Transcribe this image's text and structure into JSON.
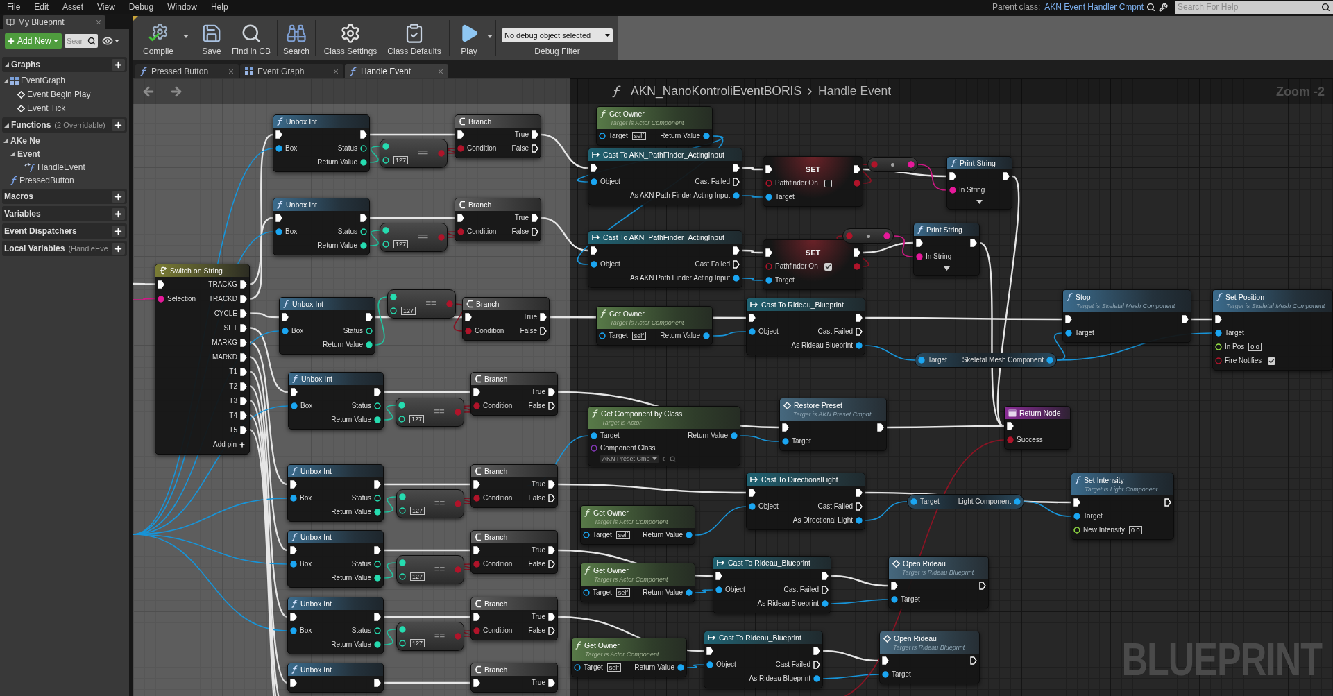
{
  "menu": [
    "File",
    "Edit",
    "Asset",
    "View",
    "Debug",
    "Window",
    "Help"
  ],
  "parent_class": {
    "label": "Parent class:",
    "value": "AKN Event Handler Cmpnt"
  },
  "help_search": {
    "placeholder": "Search For Help"
  },
  "sidebar": {
    "tab": "My Blueprint",
    "add_button": "Add New",
    "search": {
      "placeholder": "Sear"
    },
    "sections": [
      {
        "title": "Graphs",
        "expanded": true,
        "items": [
          {
            "label": "EventGraph",
            "kind": "graph",
            "expanded": true,
            "children": [
              {
                "label": "Event Begin Play",
                "kind": "event"
              },
              {
                "label": "Event Tick",
                "kind": "event"
              }
            ]
          }
        ]
      },
      {
        "title": "Functions",
        "note": "(2 Overridable)",
        "expanded": true,
        "items": [
          {
            "label": "AKe Ne",
            "kind": "category",
            "expanded": true,
            "children": [
              {
                "label": "Event",
                "kind": "category",
                "expanded": true,
                "children": [
                  {
                    "label": "HandleEvent",
                    "kind": "override"
                  }
                ]
              }
            ]
          },
          {
            "label": "PressedButton",
            "kind": "function"
          }
        ]
      },
      {
        "title": "Macros"
      },
      {
        "title": "Variables"
      },
      {
        "title": "Event Dispatchers"
      },
      {
        "title": "Local Variables",
        "note": "(HandleEve"
      }
    ]
  },
  "toolbar": {
    "buttons": [
      {
        "label": "Compile",
        "kind": "compile",
        "menu": true
      },
      {
        "label": "Save",
        "kind": "save",
        "menu": false
      },
      {
        "label": "Find in CB",
        "kind": "find",
        "menu": false
      },
      {
        "label": "Search",
        "kind": "search",
        "menu": false
      },
      {
        "label": "Class Settings",
        "kind": "class_settings",
        "menu": false
      },
      {
        "label": "Class Defaults",
        "kind": "class_defaults",
        "menu": false
      },
      {
        "label": "Play",
        "kind": "play",
        "menu": true
      }
    ],
    "debug_filter": {
      "value": "No debug object selected",
      "label": "Debug Filter"
    }
  },
  "tabs": [
    {
      "label": "Pressed Button",
      "kind": "function",
      "selected": false
    },
    {
      "label": "Event Graph",
      "kind": "graph",
      "selected": false
    },
    {
      "label": "Handle Event",
      "kind": "function",
      "selected": true
    }
  ],
  "graph": {
    "breadcrumb": {
      "blueprint": "AKN_NanoKontroliEventBORIS",
      "function": "Handle Event"
    },
    "zoom": "Zoom -2",
    "label": "BLUEPRINT",
    "nodes": [
      {
        "kind": "switch",
        "title": "Switch on String",
        "inputs": [
          {
            "kind": "exec",
            "linked": true
          },
          {
            "label": "Selection",
            "kind": "string",
            "linked": true
          }
        ],
        "outputs": [
          {
            "label": "TRACKG",
            "kind": "exec",
            "linked": true
          },
          {
            "label": "TRACKD",
            "kind": "exec",
            "linked": true
          },
          {
            "label": "CYCLE",
            "kind": "exec",
            "linked": true
          },
          {
            "label": "SET",
            "kind": "exec",
            "linked": true
          },
          {
            "label": "MARKG",
            "kind": "exec",
            "linked": true
          },
          {
            "label": "MARKD",
            "kind": "exec",
            "linked": true
          },
          {
            "label": "T1",
            "kind": "exec",
            "linked": true
          },
          {
            "label": "T2",
            "kind": "exec",
            "linked": true
          },
          {
            "label": "T3",
            "kind": "exec",
            "linked": true
          },
          {
            "label": "T4",
            "kind": "exec",
            "linked": true
          },
          {
            "label": "T5",
            "kind": "exec",
            "linked": true
          }
        ],
        "add_pin": "Add pin"
      },
      {
        "kind": "function",
        "title": "Unbox Int",
        "inputs": [
          {
            "kind": "exec",
            "linked": true
          },
          {
            "label": "Box",
            "kind": "object",
            "linked": true
          }
        ],
        "outputs": [
          {
            "kind": "exec",
            "linked": true
          },
          {
            "label": "Status",
            "kind": "int",
            "linked": false
          },
          {
            "label": "Return Value",
            "kind": "int",
            "linked": true
          }
        ]
      },
      {
        "kind": "compare",
        "label": "==",
        "inputs": [
          {
            "kind": "int",
            "linked": true
          },
          {
            "kind": "int",
            "linked": false,
            "value": "127"
          }
        ],
        "outputs": [
          {
            "kind": "bool",
            "linked": true
          }
        ]
      },
      {
        "kind": "branch",
        "title": "Branch",
        "inputs": [
          {
            "kind": "exec",
            "linked": true
          },
          {
            "label": "Condition",
            "kind": "bool",
            "linked": true
          }
        ],
        "outputs": [
          {
            "label": "True",
            "kind": "exec",
            "linked": true
          },
          {
            "label": "False",
            "kind": "exec",
            "linked": false
          }
        ]
      },
      {
        "kind": "function",
        "title": "Unbox Int",
        "inputs": [
          {
            "kind": "exec",
            "linked": true
          },
          {
            "label": "Box",
            "kind": "object",
            "linked": true
          }
        ],
        "outputs": [
          {
            "kind": "exec",
            "linked": true
          },
          {
            "label": "Status",
            "kind": "int",
            "linked": false
          },
          {
            "label": "Return Value",
            "kind": "int",
            "linked": true
          }
        ]
      },
      {
        "kind": "compare",
        "label": "==",
        "inputs": [
          {
            "kind": "int",
            "linked": true
          },
          {
            "kind": "int",
            "linked": false,
            "value": "127"
          }
        ],
        "outputs": [
          {
            "kind": "bool",
            "linked": true
          }
        ]
      },
      {
        "kind": "branch",
        "title": "Branch",
        "inputs": [
          {
            "kind": "exec",
            "linked": true
          },
          {
            "label": "Condition",
            "kind": "bool",
            "linked": true
          }
        ],
        "outputs": [
          {
            "label": "True",
            "kind": "exec",
            "linked": true
          },
          {
            "label": "False",
            "kind": "exec",
            "linked": false
          }
        ]
      },
      {
        "kind": "function",
        "title": "Unbox Int",
        "inputs": [
          {
            "kind": "exec",
            "linked": true
          },
          {
            "label": "Box",
            "kind": "object",
            "linked": true
          }
        ],
        "outputs": [
          {
            "kind": "exec",
            "linked": true
          },
          {
            "label": "Status",
            "kind": "int",
            "linked": false
          },
          {
            "label": "Return Value",
            "kind": "int",
            "linked": true
          }
        ]
      },
      {
        "kind": "compare",
        "label": "==",
        "inputs": [
          {
            "kind": "int",
            "linked": true
          },
          {
            "kind": "int",
            "linked": false,
            "value": "127"
          }
        ],
        "outputs": [
          {
            "kind": "bool",
            "linked": true
          }
        ]
      },
      {
        "kind": "branch",
        "title": "Branch",
        "inputs": [
          {
            "kind": "exec",
            "linked": true
          },
          {
            "label": "Condition",
            "kind": "bool",
            "linked": true
          }
        ],
        "outputs": [
          {
            "label": "True",
            "kind": "exec",
            "linked": true
          },
          {
            "label": "False",
            "kind": "exec",
            "linked": false
          }
        ]
      },
      {
        "kind": "function",
        "title": "Unbox Int",
        "inputs": [
          {
            "kind": "exec",
            "linked": true
          },
          {
            "label": "Box",
            "kind": "object",
            "linked": true
          }
        ],
        "outputs": [
          {
            "kind": "exec",
            "linked": true
          },
          {
            "label": "Status",
            "kind": "int",
            "linked": false
          },
          {
            "label": "Return Value",
            "kind": "int",
            "linked": true
          }
        ]
      },
      {
        "kind": "compare",
        "label": "==",
        "inputs": [
          {
            "kind": "int",
            "linked": true
          },
          {
            "kind": "int",
            "linked": false,
            "value": "127"
          }
        ],
        "outputs": [
          {
            "kind": "bool",
            "linked": true
          }
        ]
      },
      {
        "kind": "branch",
        "title": "Branch",
        "inputs": [
          {
            "kind": "exec",
            "linked": true
          },
          {
            "label": "Condition",
            "kind": "bool",
            "linked": true
          }
        ],
        "outputs": [
          {
            "label": "True",
            "kind": "exec",
            "linked": true
          },
          {
            "label": "False",
            "kind": "exec",
            "linked": false
          }
        ]
      },
      {
        "kind": "function",
        "title": "Unbox Int",
        "inputs": [
          {
            "kind": "exec",
            "linked": true
          },
          {
            "label": "Box",
            "kind": "object",
            "linked": true
          }
        ],
        "outputs": [
          {
            "kind": "exec",
            "linked": true
          },
          {
            "label": "Status",
            "kind": "int",
            "linked": false
          },
          {
            "label": "Return Value",
            "kind": "int",
            "linked": true
          }
        ]
      },
      {
        "kind": "compare",
        "label": "==",
        "inputs": [
          {
            "kind": "int",
            "linked": true
          },
          {
            "kind": "int",
            "linked": false,
            "value": "127"
          }
        ],
        "outputs": [
          {
            "kind": "bool",
            "linked": true
          }
        ]
      },
      {
        "kind": "branch",
        "title": "Branch",
        "inputs": [
          {
            "kind": "exec",
            "linked": true
          },
          {
            "label": "Condition",
            "kind": "bool",
            "linked": true
          }
        ],
        "outputs": [
          {
            "label": "True",
            "kind": "exec",
            "linked": true
          },
          {
            "label": "False",
            "kind": "exec",
            "linked": false
          }
        ]
      },
      {
        "kind": "function",
        "title": "Unbox Int",
        "inputs": [
          {
            "kind": "exec",
            "linked": true
          },
          {
            "label": "Box",
            "kind": "object",
            "linked": true
          }
        ],
        "outputs": [
          {
            "kind": "exec",
            "linked": true
          },
          {
            "label": "Status",
            "kind": "int",
            "linked": false
          },
          {
            "label": "Return Value",
            "kind": "int",
            "linked": true
          }
        ]
      },
      {
        "kind": "compare",
        "label": "==",
        "inputs": [
          {
            "kind": "int",
            "linked": true
          },
          {
            "kind": "int",
            "linked": false,
            "value": "127"
          }
        ],
        "outputs": [
          {
            "kind": "bool",
            "linked": true
          }
        ]
      },
      {
        "kind": "branch",
        "title": "Branch",
        "inputs": [
          {
            "kind": "exec",
            "linked": true
          },
          {
            "label": "Condition",
            "kind": "bool",
            "linked": true
          }
        ],
        "outputs": [
          {
            "label": "True",
            "kind": "exec",
            "linked": true
          },
          {
            "label": "False",
            "kind": "exec",
            "linked": false
          }
        ]
      },
      {
        "kind": "function",
        "title": "Unbox Int",
        "inputs": [
          {
            "kind": "exec",
            "linked": true
          },
          {
            "label": "Box",
            "kind": "object",
            "linked": true
          }
        ],
        "outputs": [
          {
            "kind": "exec",
            "linked": true
          },
          {
            "label": "Status",
            "kind": "int",
            "linked": false
          },
          {
            "label": "Return Value",
            "kind": "int",
            "linked": true
          }
        ]
      },
      {
        "kind": "compare",
        "label": "==",
        "inputs": [
          {
            "kind": "int",
            "linked": true
          },
          {
            "kind": "int",
            "linked": false,
            "value": "127"
          }
        ],
        "outputs": [
          {
            "kind": "bool",
            "linked": true
          }
        ]
      },
      {
        "kind": "branch",
        "title": "Branch",
        "inputs": [
          {
            "kind": "exec",
            "linked": true
          },
          {
            "label": "Condition",
            "kind": "bool",
            "linked": true
          }
        ],
        "outputs": [
          {
            "label": "True",
            "kind": "exec",
            "linked": true
          },
          {
            "label": "False",
            "kind": "exec",
            "linked": false
          }
        ]
      },
      {
        "kind": "function",
        "title": "Unbox Int",
        "inputs": [
          {
            "kind": "exec",
            "linked": true
          }
        ],
        "outputs": [
          {
            "kind": "exec",
            "linked": true
          }
        ]
      },
      {
        "kind": "branch",
        "title": "Branch",
        "inputs": [
          {
            "kind": "exec",
            "linked": true
          }
        ],
        "outputs": [
          {
            "label": "True",
            "kind": "exec",
            "linked": true
          }
        ]
      },
      {
        "kind": "pure",
        "title": "Get Owner",
        "subtitle": "Target is Actor Component",
        "inputs": [
          {
            "label": "Target",
            "kind": "object",
            "linked": false,
            "value": "self"
          }
        ],
        "outputs": [
          {
            "label": "Return Value",
            "kind": "object",
            "linked": true
          }
        ]
      },
      {
        "kind": "cast",
        "title": "Cast To AKN_PathFinder_ActingInput",
        "inputs": [
          {
            "kind": "exec",
            "linked": true
          },
          {
            "label": "Object",
            "kind": "object",
            "linked": true
          }
        ],
        "outputs": [
          {
            "kind": "exec",
            "linked": true
          },
          {
            "label": "Cast Failed",
            "kind": "exec",
            "linked": false
          },
          {
            "label": "As AKN Path Finder Acting Input",
            "kind": "object",
            "linked": true
          }
        ]
      },
      {
        "kind": "set",
        "title": "SET",
        "inputs": [
          {
            "kind": "exec",
            "linked": true
          },
          {
            "label": "Pathfinder On",
            "kind": "bool",
            "linked": false,
            "checked": false
          },
          {
            "label": "Target",
            "kind": "object",
            "linked": true
          }
        ],
        "outputs": [
          {
            "kind": "exec",
            "linked": true
          },
          {
            "kind": "bool",
            "linked": true
          }
        ]
      },
      {
        "kind": "convert",
        "inputs": [
          {
            "kind": "bool",
            "linked": true
          }
        ],
        "outputs": [
          {
            "kind": "string",
            "linked": true
          }
        ]
      },
      {
        "kind": "function",
        "title": "Print String",
        "inputs": [
          {
            "kind": "exec",
            "linked": true
          },
          {
            "label": "In String",
            "kind": "string",
            "linked": true
          }
        ],
        "outputs": [
          {
            "kind": "exec",
            "linked": true
          }
        ],
        "advanced_pins_hidden": true
      },
      {
        "kind": "cast",
        "title": "Cast To AKN_PathFinder_ActingInput",
        "inputs": [
          {
            "kind": "exec",
            "linked": true
          },
          {
            "label": "Object",
            "kind": "object",
            "linked": true
          }
        ],
        "outputs": [
          {
            "kind": "exec",
            "linked": true
          },
          {
            "label": "Cast Failed",
            "kind": "exec",
            "linked": false
          },
          {
            "label": "As AKN Path Finder Acting Input",
            "kind": "object",
            "linked": true
          }
        ]
      },
      {
        "kind": "set",
        "title": "SET",
        "inputs": [
          {
            "kind": "exec",
            "linked": true
          },
          {
            "label": "Pathfinder On",
            "kind": "bool",
            "linked": false,
            "checked": true
          },
          {
            "label": "Target",
            "kind": "object",
            "linked": true
          }
        ],
        "outputs": [
          {
            "kind": "exec",
            "linked": true
          },
          {
            "kind": "bool",
            "linked": true
          }
        ]
      },
      {
        "kind": "convert",
        "inputs": [
          {
            "kind": "bool",
            "linked": true
          }
        ],
        "outputs": [
          {
            "kind": "string",
            "linked": true
          }
        ]
      },
      {
        "kind": "function",
        "title": "Print String",
        "inputs": [
          {
            "kind": "exec",
            "linked": true
          },
          {
            "label": "In String",
            "kind": "string",
            "linked": true
          }
        ],
        "outputs": [
          {
            "kind": "exec",
            "linked": true
          }
        ],
        "advanced_pins_hidden": true
      },
      {
        "kind": "pure",
        "title": "Get Owner",
        "subtitle": "Target is Actor Component",
        "inputs": [
          {
            "label": "Target",
            "kind": "object",
            "linked": false,
            "value": "self"
          }
        ],
        "outputs": [
          {
            "label": "Return Value",
            "kind": "object",
            "linked": true
          }
        ]
      },
      {
        "kind": "cast",
        "title": "Cast To Rideau_Blueprint",
        "inputs": [
          {
            "kind": "exec",
            "linked": true
          },
          {
            "label": "Object",
            "kind": "object",
            "linked": true
          }
        ],
        "outputs": [
          {
            "kind": "exec",
            "linked": true
          },
          {
            "label": "Cast Failed",
            "kind": "exec",
            "linked": false
          },
          {
            "label": "As Rideau Blueprint",
            "kind": "object",
            "linked": true
          }
        ]
      },
      {
        "kind": "component",
        "inputs": [
          {
            "label": "Target",
            "kind": "object",
            "linked": true
          }
        ],
        "outputs": [
          {
            "label": "Skeletal Mesh Component",
            "kind": "object",
            "linked": true
          }
        ]
      },
      {
        "kind": "function",
        "title": "Stop",
        "subtitle": "Target is Skeletal Mesh Component",
        "inputs": [
          {
            "kind": "exec",
            "linked": true
          },
          {
            "label": "Target",
            "kind": "object",
            "linked": true
          }
        ],
        "outputs": [
          {
            "kind": "exec",
            "linked": true
          }
        ]
      },
      {
        "kind": "function",
        "title": "Set Position",
        "subtitle": "Target is Skeletal Mesh Component",
        "inputs": [
          {
            "kind": "exec",
            "linked": true
          },
          {
            "label": "Target",
            "kind": "object",
            "linked": true
          },
          {
            "label": "In Pos",
            "kind": "float",
            "linked": false,
            "value": "0.0"
          },
          {
            "label": "Fire Notifies",
            "kind": "bool",
            "linked": false,
            "checked": true
          }
        ]
      },
      {
        "kind": "pure",
        "title": "Get Component by Class",
        "subtitle": "Target is Actor",
        "inputs": [
          {
            "label": "Target",
            "kind": "object",
            "linked": true
          },
          {
            "label": "Component Class",
            "kind": "class",
            "linked": false,
            "value": "AKN Preset Cmp"
          }
        ],
        "outputs": [
          {
            "label": "Return Value",
            "kind": "object",
            "linked": true
          }
        ]
      },
      {
        "kind": "message",
        "title": "Restore Preset",
        "subtitle": "Target is AKN Preset Cmpnt",
        "inputs": [
          {
            "kind": "exec",
            "linked": true
          },
          {
            "label": "Target",
            "kind": "object",
            "linked": true
          }
        ],
        "outputs": [
          {
            "kind": "exec",
            "linked": true
          }
        ]
      },
      {
        "kind": "return",
        "title": "Return Node",
        "inputs": [
          {
            "kind": "exec",
            "linked": true
          },
          {
            "label": "Success",
            "kind": "bool",
            "linked": true
          }
        ]
      },
      {
        "kind": "cast",
        "title": "Cast To DirectionalLight",
        "inputs": [
          {
            "kind": "exec",
            "linked": true
          },
          {
            "label": "Object",
            "kind": "object",
            "linked": true
          }
        ],
        "outputs": [
          {
            "kind": "exec",
            "linked": true
          },
          {
            "label": "Cast Failed",
            "kind": "exec",
            "linked": false
          },
          {
            "label": "As Directional Light",
            "kind": "object",
            "linked": true
          }
        ]
      },
      {
        "kind": "pure",
        "title": "Get Owner",
        "subtitle": "Target is Actor Component",
        "inputs": [
          {
            "label": "Target",
            "kind": "object",
            "linked": false,
            "value": "self"
          }
        ],
        "outputs": [
          {
            "label": "Return Value",
            "kind": "object",
            "linked": true
          }
        ]
      },
      {
        "kind": "component",
        "inputs": [
          {
            "label": "Target",
            "kind": "object",
            "linked": true
          }
        ],
        "outputs": [
          {
            "label": "Light Component",
            "kind": "object",
            "linked": true
          }
        ]
      },
      {
        "kind": "function",
        "title": "Set Intensity",
        "subtitle": "Target is Light Component",
        "inputs": [
          {
            "kind": "exec",
            "linked": true
          },
          {
            "label": "Target",
            "kind": "object",
            "linked": true
          },
          {
            "label": "New Intensity",
            "kind": "float",
            "linked": false,
            "value": "0.0"
          }
        ],
        "outputs": [
          {
            "kind": "exec",
            "linked": false
          }
        ]
      },
      {
        "kind": "pure",
        "title": "Get Owner",
        "subtitle": "Target is Actor Component",
        "inputs": [
          {
            "label": "Target",
            "kind": "object",
            "linked": false,
            "value": "self"
          }
        ],
        "outputs": [
          {
            "label": "Return Value",
            "kind": "object",
            "linked": true
          }
        ]
      },
      {
        "kind": "cast",
        "title": "Cast To Rideau_Blueprint",
        "inputs": [
          {
            "kind": "exec",
            "linked": true
          },
          {
            "label": "Object",
            "kind": "object",
            "linked": true
          }
        ],
        "outputs": [
          {
            "kind": "exec",
            "linked": true
          },
          {
            "label": "Cast Failed",
            "kind": "exec",
            "linked": false
          },
          {
            "label": "As Rideau Blueprint",
            "kind": "object",
            "linked": true
          }
        ]
      },
      {
        "kind": "message",
        "title": "Open Rideau",
        "subtitle": "Target is Rideau Blueprint",
        "inputs": [
          {
            "kind": "exec",
            "linked": true
          },
          {
            "label": "Target",
            "kind": "object",
            "linked": true
          }
        ],
        "outputs": [
          {
            "kind": "exec",
            "linked": false
          }
        ]
      },
      {
        "kind": "pure",
        "title": "Get Owner",
        "subtitle": "Target is Actor Component",
        "inputs": [
          {
            "label": "Target",
            "kind": "object",
            "linked": false,
            "value": "self"
          }
        ],
        "outputs": [
          {
            "label": "Return Value",
            "kind": "object",
            "linked": true
          }
        ]
      },
      {
        "kind": "cast",
        "title": "Cast To Rideau_Blueprint",
        "inputs": [
          {
            "kind": "exec",
            "linked": true
          },
          {
            "label": "Object",
            "kind": "object",
            "linked": true
          }
        ],
        "outputs": [
          {
            "kind": "exec",
            "linked": true
          },
          {
            "label": "Cast Failed",
            "kind": "exec",
            "linked": false
          },
          {
            "label": "As Rideau Blueprint",
            "kind": "object",
            "linked": true
          }
        ]
      },
      {
        "kind": "message",
        "title": "Open Rideau",
        "subtitle": "Target is Rideau Blueprint",
        "inputs": [
          {
            "kind": "exec",
            "linked": true
          },
          {
            "label": "Target",
            "kind": "object",
            "linked": true
          }
        ],
        "outputs": [
          {
            "kind": "exec",
            "linked": false
          }
        ]
      }
    ]
  }
}
